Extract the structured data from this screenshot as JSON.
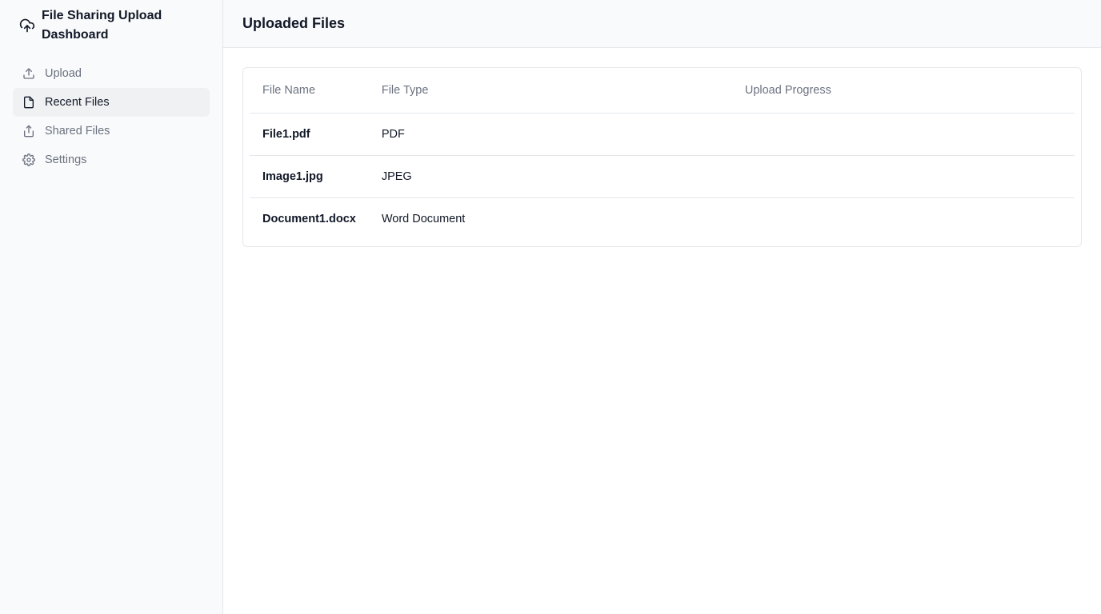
{
  "sidebar": {
    "brand": {
      "title": "File Sharing Upload Dashboard",
      "icon": "cloud-upload-icon"
    },
    "items": [
      {
        "label": "Upload",
        "icon": "upload-icon",
        "active": false
      },
      {
        "label": "Recent Files",
        "icon": "file-icon",
        "active": true
      },
      {
        "label": "Shared Files",
        "icon": "share-icon",
        "active": false
      },
      {
        "label": "Settings",
        "icon": "gear-icon",
        "active": false
      }
    ]
  },
  "header": {
    "title": "Uploaded Files"
  },
  "table": {
    "columns": [
      "File Name",
      "File Type",
      "Upload Progress"
    ],
    "rows": [
      {
        "name": "File1.pdf",
        "type": "PDF",
        "progress": ""
      },
      {
        "name": "Image1.jpg",
        "type": "JPEG",
        "progress": ""
      },
      {
        "name": "Document1.docx",
        "type": "Word Document",
        "progress": ""
      }
    ]
  },
  "colors": {
    "sidebar_bg": "#f9fafb",
    "active_item_bg": "#f0f1f3",
    "muted_text": "#6b7280",
    "border": "#e5e7eb"
  }
}
